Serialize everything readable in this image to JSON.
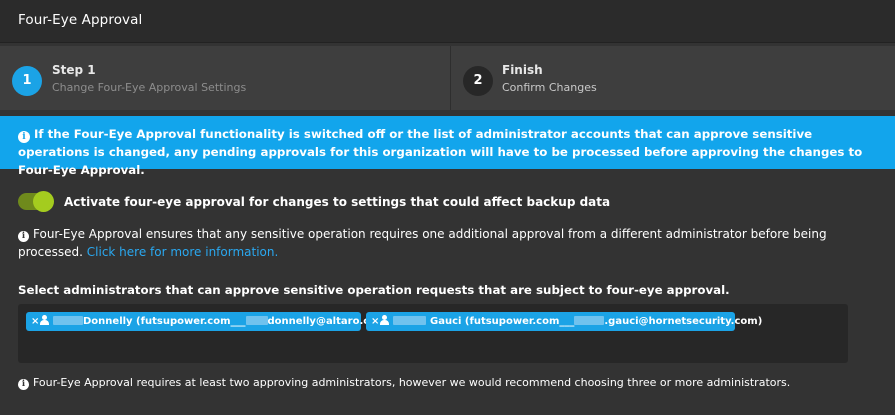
{
  "window": {
    "title": "Four-Eye Approval"
  },
  "steps": [
    {
      "number": "1",
      "title": "Step 1",
      "subtitle": "Change Four-Eye Approval Settings",
      "active": true
    },
    {
      "number": "2",
      "title": "Finish",
      "subtitle": "Confirm Changes",
      "active": false
    }
  ],
  "info_banner": {
    "icon": "info-icon",
    "text": "If the Four-Eye Approval functionality is switched off or the list of administrator accounts that can approve sensitive operations is changed, any pending approvals for this organization will have to be processed before approving the changes to Four-Eye Approval."
  },
  "toggle": {
    "label": "Activate four-eye approval for changes to settings that could affect backup data",
    "state": "on"
  },
  "description": {
    "icon": "info-icon",
    "text": "Four-Eye Approval ensures that any sensitive operation requires one additional approval from a different administrator before being processed.",
    "link_text": "Click here for more information."
  },
  "admins": {
    "label": "Select administrators that can approve sensitive operation requests that are subject to four-eye approval.",
    "chips": [
      {
        "remove": "×",
        "icon": "user-icon",
        "text_a": "Donnelly (futsupower.com___",
        "text_b": "donnelly@altaro.com)"
      },
      {
        "remove": "×",
        "icon": "user-icon",
        "text_a": "Gauci (futsupower.com___",
        "text_b": ".gauci@hornetsecurity.com)"
      }
    ]
  },
  "footnote": {
    "icon": "info-icon",
    "text": "Four-Eye Approval requires at least two approving administrators, however we would recommend choosing three or more administrators."
  },
  "colors": {
    "accent": "#1ba3e6",
    "banner": "#12a5ec",
    "toggle_on": "#a4cc1f",
    "background": "#333333"
  }
}
